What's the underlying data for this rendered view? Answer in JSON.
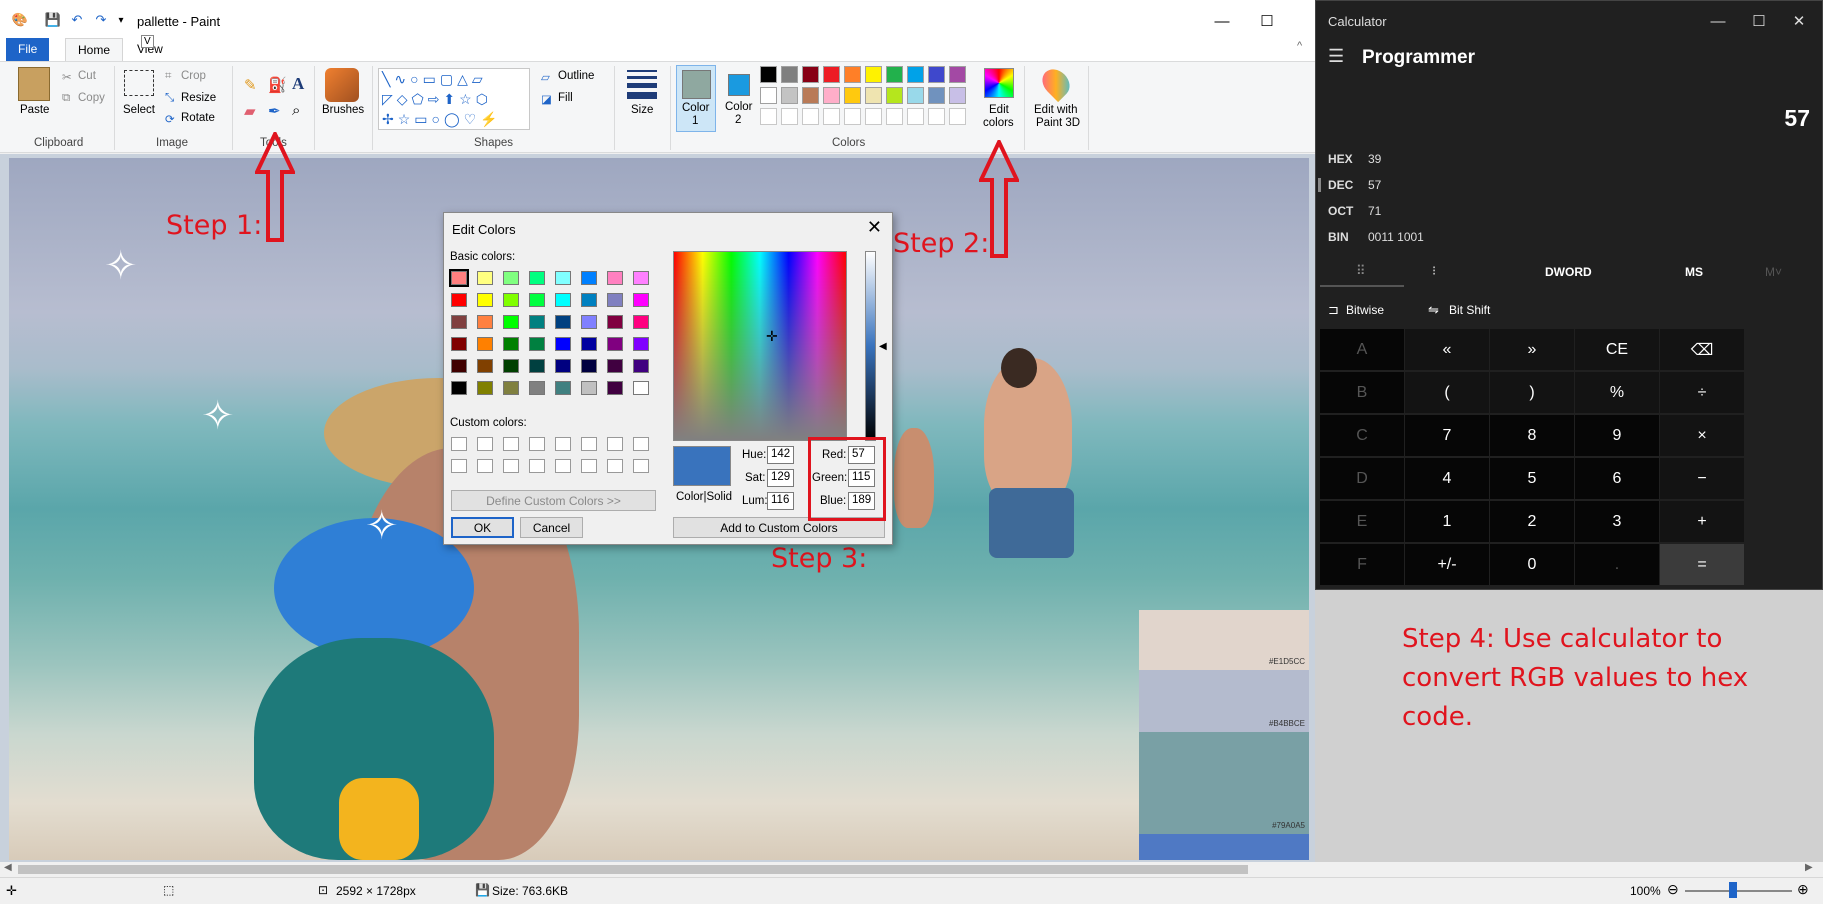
{
  "paint": {
    "window_title": "pallette - Paint",
    "quick_access_hint": "V",
    "tabs": {
      "file": "File",
      "home": "Home",
      "view": "View"
    },
    "clipboard": {
      "paste": "Paste",
      "cut": "Cut",
      "copy": "Copy",
      "group": "Clipboard"
    },
    "image": {
      "select": "Select",
      "crop": "Crop",
      "resize": "Resize",
      "rotate": "Rotate",
      "group": "Image"
    },
    "tools": {
      "group": "Tools"
    },
    "brushes": "Brushes",
    "shapes": {
      "outline": "Outline",
      "fill": "Fill",
      "group": "Shapes"
    },
    "size": "Size",
    "color1": {
      "label1": "Color",
      "label2": "1",
      "value": "#8fa8a0"
    },
    "color2": {
      "label1": "Color",
      "label2": "2",
      "value": "#1a9ae0"
    },
    "colors_group": "Colors",
    "palette_row1": [
      "#000000",
      "#7f7f7f",
      "#880015",
      "#ed1c24",
      "#ff7f27",
      "#fff200",
      "#22b14c",
      "#00a2e8",
      "#3f48cc",
      "#a349a4"
    ],
    "palette_row2": [
      "#ffffff",
      "#c3c3c3",
      "#b97a57",
      "#ffaec9",
      "#ffc90e",
      "#efe4b0",
      "#b5e61d",
      "#99d9ea",
      "#7092be",
      "#c8bfe7"
    ],
    "edit_colors": {
      "line1": "Edit",
      "line2": "colors"
    },
    "paint3d": {
      "line1": "Edit with",
      "line2": "Paint 3D"
    },
    "status": {
      "dimensions": "2592 × 1728px",
      "size": "Size: 763.6KB",
      "zoom": "100%"
    }
  },
  "palette_strips": [
    {
      "hex": "#E1D5CC",
      "color": "#e1d5cc"
    },
    {
      "hex": "#B4BBCE",
      "color": "#b4bbce"
    },
    {
      "hex": "#79A0A5",
      "color": "#79a0a5"
    },
    {
      "hex": "",
      "color": "#4f79c4"
    }
  ],
  "annotations": {
    "step1": "Step 1:",
    "step2": "Step 2:",
    "step3": "Step 3:",
    "step4": "Step 4: Use calculator to convert RGB values to hex code."
  },
  "edit_colors_dialog": {
    "title": "Edit Colors",
    "basic_label": "Basic colors:",
    "custom_label": "Custom colors:",
    "basic_colors": [
      "#ff8080",
      "#ffff80",
      "#80ff80",
      "#00ff80",
      "#80ffff",
      "#0080ff",
      "#ff80c0",
      "#ff80ff",
      "#ff0000",
      "#ffff00",
      "#80ff00",
      "#00ff40",
      "#00ffff",
      "#0080c0",
      "#8080c0",
      "#ff00ff",
      "#804040",
      "#ff8040",
      "#00ff00",
      "#008080",
      "#004080",
      "#8080ff",
      "#800040",
      "#ff0080",
      "#800000",
      "#ff8000",
      "#008000",
      "#008040",
      "#0000ff",
      "#0000a0",
      "#800080",
      "#8000ff",
      "#400000",
      "#804000",
      "#004000",
      "#004040",
      "#000080",
      "#000040",
      "#400040",
      "#400080",
      "#000000",
      "#808000",
      "#808040",
      "#808080",
      "#408080",
      "#c0c0c0",
      "#400040",
      "#ffffff"
    ],
    "define_button": "Define Custom Colors >>",
    "ok": "OK",
    "cancel": "Cancel",
    "color_solid": "Color|Solid",
    "hue_label": "Hue:",
    "hue": "142",
    "sat_label": "Sat:",
    "sat": "129",
    "lum_label": "Lum:",
    "lum": "116",
    "red_label": "Red:",
    "red": "57",
    "green_label": "Green:",
    "green": "115",
    "blue_label": "Blue:",
    "blue": "189",
    "add_button": "Add to Custom Colors",
    "selected_color": "#3973bd"
  },
  "calculator": {
    "title": "Calculator",
    "mode": "Programmer",
    "display": "57",
    "hex_label": "HEX",
    "hex": "39",
    "dec_label": "DEC",
    "dec": "57",
    "oct_label": "OCT",
    "oct": "71",
    "bin_label": "BIN",
    "bin": "0011 1001",
    "word_size": "DWORD",
    "ms": "MS",
    "mv": "M˅",
    "bitwise": "Bitwise",
    "bitshift": "Bit Shift",
    "keys": [
      [
        "A",
        "«",
        "»",
        "CE",
        "⌫"
      ],
      [
        "B",
        "(",
        ")",
        "%",
        "÷"
      ],
      [
        "C",
        "7",
        "8",
        "9",
        "×"
      ],
      [
        "D",
        "4",
        "5",
        "6",
        "−"
      ],
      [
        "E",
        "1",
        "2",
        "3",
        "+"
      ],
      [
        "F",
        "+/-",
        "0",
        ".",
        "="
      ]
    ]
  }
}
